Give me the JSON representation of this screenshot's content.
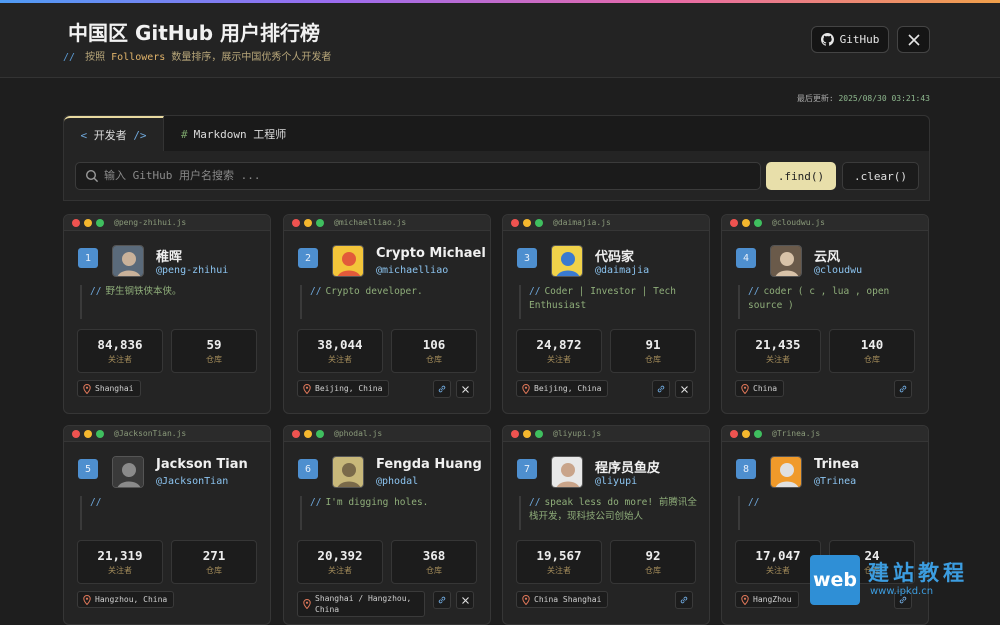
{
  "header": {
    "title": "中国区 GitHub 用户排行榜",
    "subtitle_prefix": "//",
    "subtitle_pre": "按照",
    "subtitle_keyword": "Followers",
    "subtitle_post": "数量排序，展示中国优秀个人开发者",
    "github_button": "GitHub"
  },
  "updated": {
    "label": "最后更新:",
    "time": "2025/08/30 03:21:43"
  },
  "tabs": {
    "developers": "开发者",
    "developers_open": "<",
    "developers_close": "/>",
    "markdown_hash": "#",
    "markdown": "Markdown 工程师"
  },
  "search": {
    "placeholder": "输入 GitHub 用户名搜索 ...",
    "find_label": ".find()",
    "clear_label": ".clear()"
  },
  "stat_labels": {
    "followers": "关注者",
    "repos": "仓库"
  },
  "users": [
    {
      "rank": "1",
      "file": "@peng-zhihui.js",
      "name": "稚晖",
      "login": "@peng-zhihui",
      "bio_prefix": "//",
      "bio": "野生钢铁侠本侠。",
      "followers": "84,836",
      "repos": "59",
      "location": "Shanghai",
      "has_blog": false,
      "has_x": false
    },
    {
      "rank": "2",
      "file": "@michaelliao.js",
      "name": "Crypto Michael",
      "login": "@michaelliao",
      "bio_prefix": "//",
      "bio": "Crypto developer.",
      "followers": "38,044",
      "repos": "106",
      "location": "Beijing, China",
      "has_blog": true,
      "has_x": true
    },
    {
      "rank": "3",
      "file": "@daimajia.js",
      "name": "代码家",
      "login": "@daimajia",
      "bio_prefix": "//",
      "bio": "Coder | Investor | Tech Enthusiast",
      "followers": "24,872",
      "repos": "91",
      "location": "Beijing, China",
      "has_blog": true,
      "has_x": true
    },
    {
      "rank": "4",
      "file": "@cloudwu.js",
      "name": "云风",
      "login": "@cloudwu",
      "bio_prefix": "//",
      "bio": "coder ( c , lua , open source )",
      "followers": "21,435",
      "repos": "140",
      "location": "China",
      "has_blog": true,
      "has_x": false
    },
    {
      "rank": "5",
      "file": "@JacksonTian.js",
      "name": "Jackson Tian",
      "login": "@JacksonTian",
      "bio_prefix": "//",
      "bio": "",
      "followers": "21,319",
      "repos": "271",
      "location": "Hangzhou, China",
      "has_blog": false,
      "has_x": false
    },
    {
      "rank": "6",
      "file": "@phodal.js",
      "name": "Fengda Huang",
      "login": "@phodal",
      "bio_prefix": "//",
      "bio": "I'm digging holes.",
      "followers": "20,392",
      "repos": "368",
      "location": "Shanghai / Hangzhou, China",
      "has_blog": true,
      "has_x": true
    },
    {
      "rank": "7",
      "file": "@liyupi.js",
      "name": "程序员鱼皮",
      "login": "@liyupi",
      "bio_prefix": "//",
      "bio": "speak less do more! 前腾讯全栈开发，现科技公司创始人",
      "followers": "19,567",
      "repos": "92",
      "location": "China Shanghai",
      "has_blog": true,
      "has_x": false
    },
    {
      "rank": "8",
      "file": "@Trinea.js",
      "name": "Trinea",
      "login": "@Trinea",
      "bio_prefix": "//",
      "bio": "",
      "followers": "17,047",
      "repos": "24",
      "location": "HangZhou",
      "has_blog": true,
      "has_x": false
    }
  ],
  "watermark": {
    "box": "web",
    "cn": "建站教程",
    "url": "www.ipkd.cn"
  },
  "colors": {
    "accent_yellow": "#e8dfaa",
    "rank_blue": "#4e8fcf",
    "login_blue": "#8cc4f0",
    "bio_green": "#8fae7a"
  }
}
